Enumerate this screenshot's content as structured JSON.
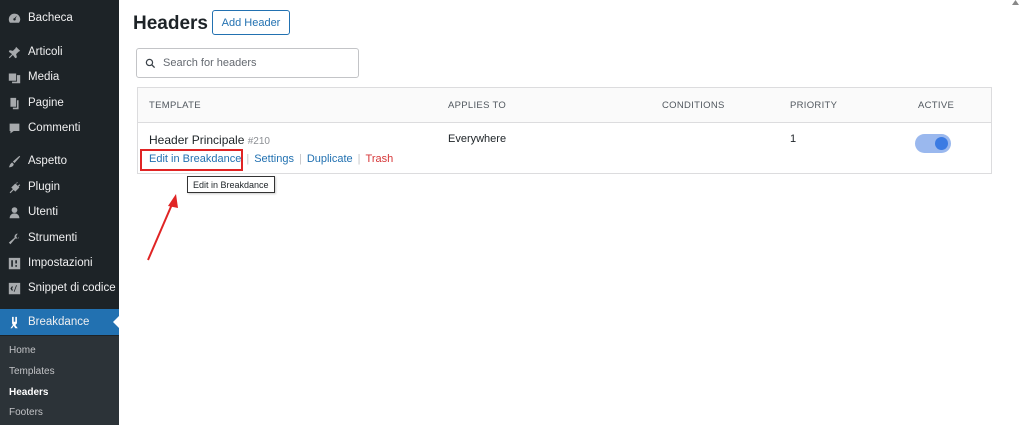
{
  "sidebar": {
    "items": [
      {
        "label": "Bacheca",
        "icon": "dashboard-icon"
      },
      {
        "label": "Articoli",
        "icon": "pin-icon"
      },
      {
        "label": "Media",
        "icon": "media-icon"
      },
      {
        "label": "Pagine",
        "icon": "pages-icon"
      },
      {
        "label": "Commenti",
        "icon": "comments-icon"
      },
      {
        "label": "Aspetto",
        "icon": "appearance-icon"
      },
      {
        "label": "Plugin",
        "icon": "plugin-icon"
      },
      {
        "label": "Utenti",
        "icon": "users-icon"
      },
      {
        "label": "Strumenti",
        "icon": "tools-icon"
      },
      {
        "label": "Impostazioni",
        "icon": "settings-icon"
      },
      {
        "label": "Snippet di codice",
        "icon": "code-snippet-icon"
      },
      {
        "label": "Breakdance",
        "icon": "breakdance-icon"
      }
    ],
    "submenu": [
      "Home",
      "Templates",
      "Headers",
      "Footers"
    ]
  },
  "page": {
    "title": "Headers",
    "add_button": "Add Header",
    "search_placeholder": "Search for headers"
  },
  "table": {
    "columns": [
      "TEMPLATE",
      "APPLIES TO",
      "CONDITIONS",
      "PRIORITY",
      "ACTIVE"
    ],
    "rows": [
      {
        "name": "Header Principale",
        "id": "#210",
        "applies_to": "Everywhere",
        "conditions": "",
        "priority": "1",
        "active": true,
        "actions": [
          "Edit in Breakdance",
          "Settings",
          "Duplicate",
          "Trash"
        ]
      }
    ]
  },
  "tooltip": "Edit in Breakdance",
  "colors": {
    "sidebar_bg": "#1d2327",
    "accent": "#2271b1",
    "trash": "#d63638",
    "annotation_red": "#e02424"
  }
}
